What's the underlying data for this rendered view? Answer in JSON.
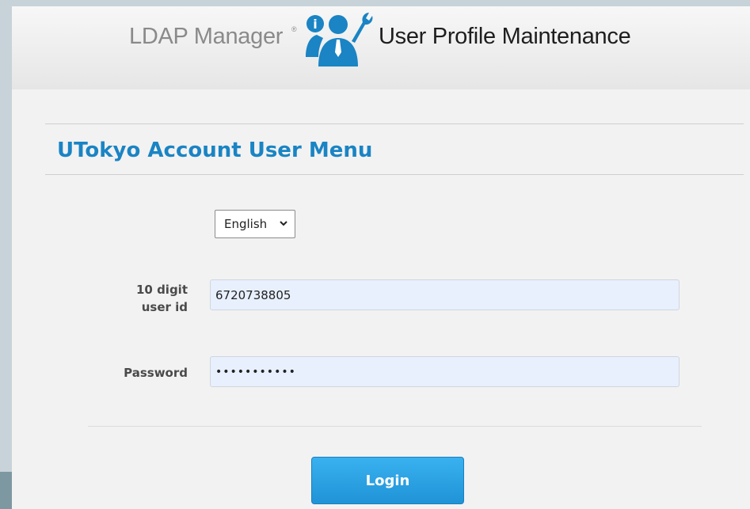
{
  "header": {
    "brand": "LDAP Manager",
    "brand_mark": "®",
    "logo_icon": "people-wrench-info-icon",
    "product_title": "User Profile Maintenance"
  },
  "menu": {
    "title": "UTokyo Account User Menu"
  },
  "language": {
    "selected": "English"
  },
  "form": {
    "userid_label": "10 digit user id",
    "userid_value": "6720738805",
    "password_label": "Password",
    "password_masked": "•••••••••••",
    "login_label": "Login"
  },
  "colors": {
    "accent": "#1a84c4",
    "button": "#2a9fe0",
    "input_bg": "#e8f0fe"
  }
}
